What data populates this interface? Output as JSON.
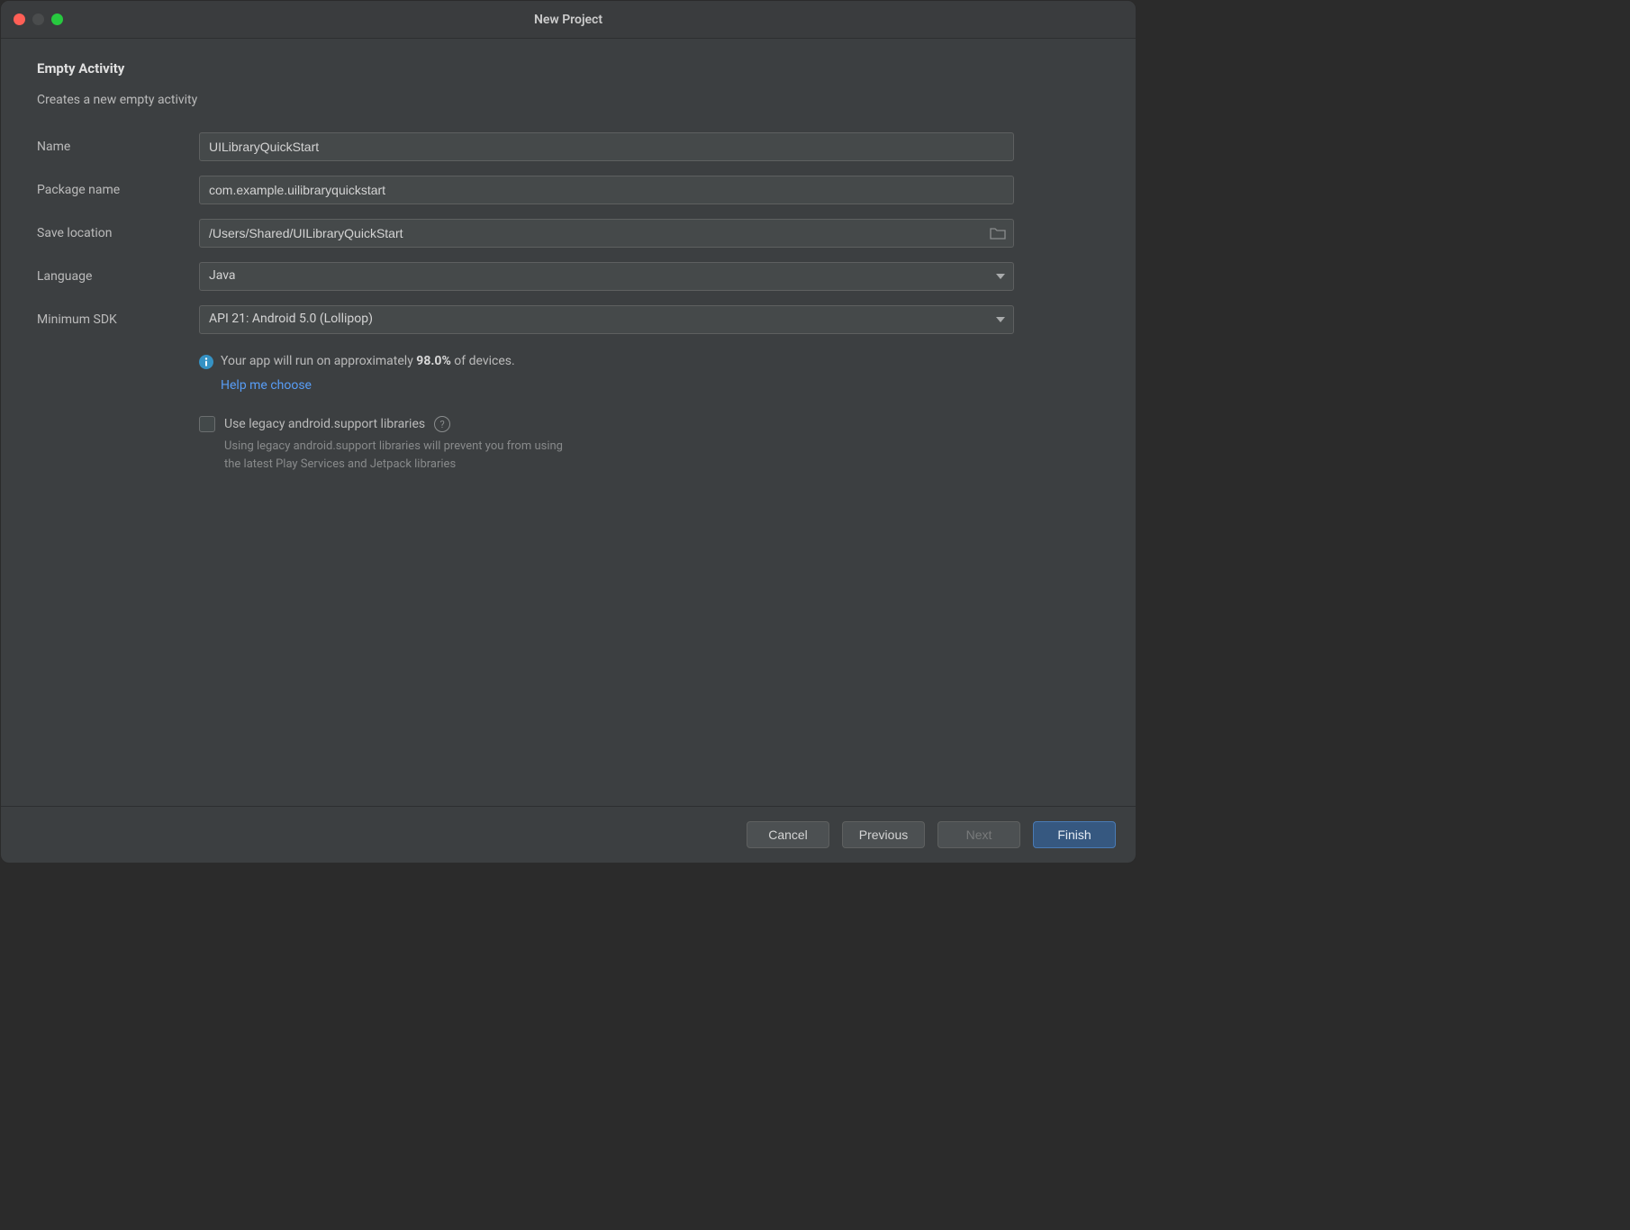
{
  "window": {
    "title": "New Project"
  },
  "page": {
    "title": "Empty Activity",
    "subtitle": "Creates a new empty activity"
  },
  "form": {
    "name_label": "Name",
    "name_value": "UILibraryQuickStart",
    "package_label": "Package name",
    "package_value": "com.example.uilibraryquickstart",
    "save_label": "Save location",
    "save_value": "/Users/Shared/UILibraryQuickStart",
    "language_label": "Language",
    "language_value": "Java",
    "minsdk_label": "Minimum SDK",
    "minsdk_value": "API 21: Android 5.0 (Lollipop)"
  },
  "info": {
    "prefix": "Your app will run on approximately ",
    "percent": "98.0%",
    "suffix": " of devices.",
    "help_link": "Help me choose"
  },
  "legacy": {
    "checkbox_label": "Use legacy android.support libraries",
    "subtext_line1": "Using legacy android.support libraries will prevent you from using",
    "subtext_line2": "the latest Play Services and Jetpack libraries"
  },
  "footer": {
    "cancel": "Cancel",
    "previous": "Previous",
    "next": "Next",
    "finish": "Finish"
  }
}
